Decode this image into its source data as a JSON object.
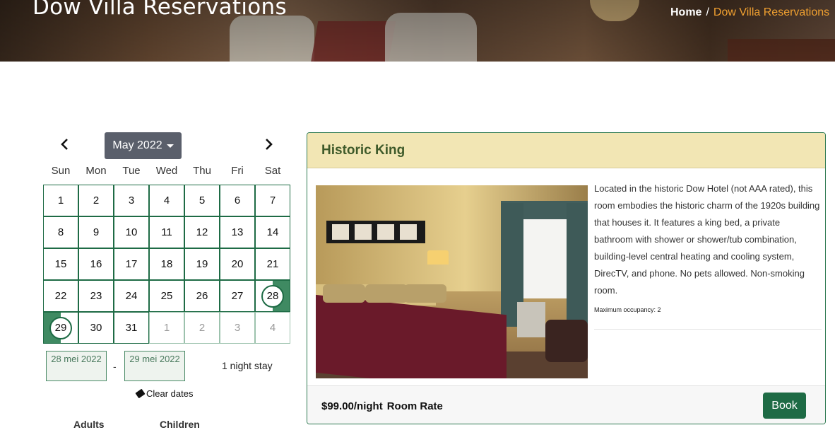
{
  "header": {
    "title": "Dow Villa Reservations",
    "breadcrumb": {
      "home": "Home",
      "separator": "/",
      "current": "Dow Villa Reservations"
    }
  },
  "calendar": {
    "prev_icon": "‹",
    "next_icon": "›",
    "month_label": "May 2022",
    "weekdays": [
      "Sun",
      "Mon",
      "Tue",
      "Wed",
      "Thu",
      "Fri",
      "Sat"
    ],
    "weeks": [
      [
        "1",
        "2",
        "3",
        "4",
        "5",
        "6",
        "7"
      ],
      [
        "8",
        "9",
        "10",
        "11",
        "12",
        "13",
        "14"
      ],
      [
        "15",
        "16",
        "17",
        "18",
        "19",
        "20",
        "21"
      ],
      [
        "22",
        "23",
        "24",
        "25",
        "26",
        "27",
        "28"
      ],
      [
        "29",
        "30",
        "31",
        "1",
        "2",
        "3",
        "4"
      ]
    ],
    "check_in": "28 mei 2022",
    "check_out": "29 mei 2022",
    "range_dash": "-",
    "stay_text": "1 night stay",
    "clear_label": "Clear dates",
    "adults_label": "Adults",
    "children_label": "Children"
  },
  "room": {
    "title": "Historic King",
    "description": "Located in the historic Dow Hotel (not AAA rated), this room embodies the historic charm of the 1920s building that houses it. It features a king bed, a private bathroom with shower or shower/tub combination, building-level central heating and cooling system, DirecTV, and phone. No pets allowed. Non-smoking room.",
    "occupancy": "Maximum occupancy: 2",
    "price": "$99.00/night",
    "rate_label": "Room Rate",
    "book_label": "Book"
  },
  "colors": {
    "accent_green": "#1e6b45",
    "breadcrumb_orange": "#f0a030",
    "card_header": "#f2e6b4"
  }
}
